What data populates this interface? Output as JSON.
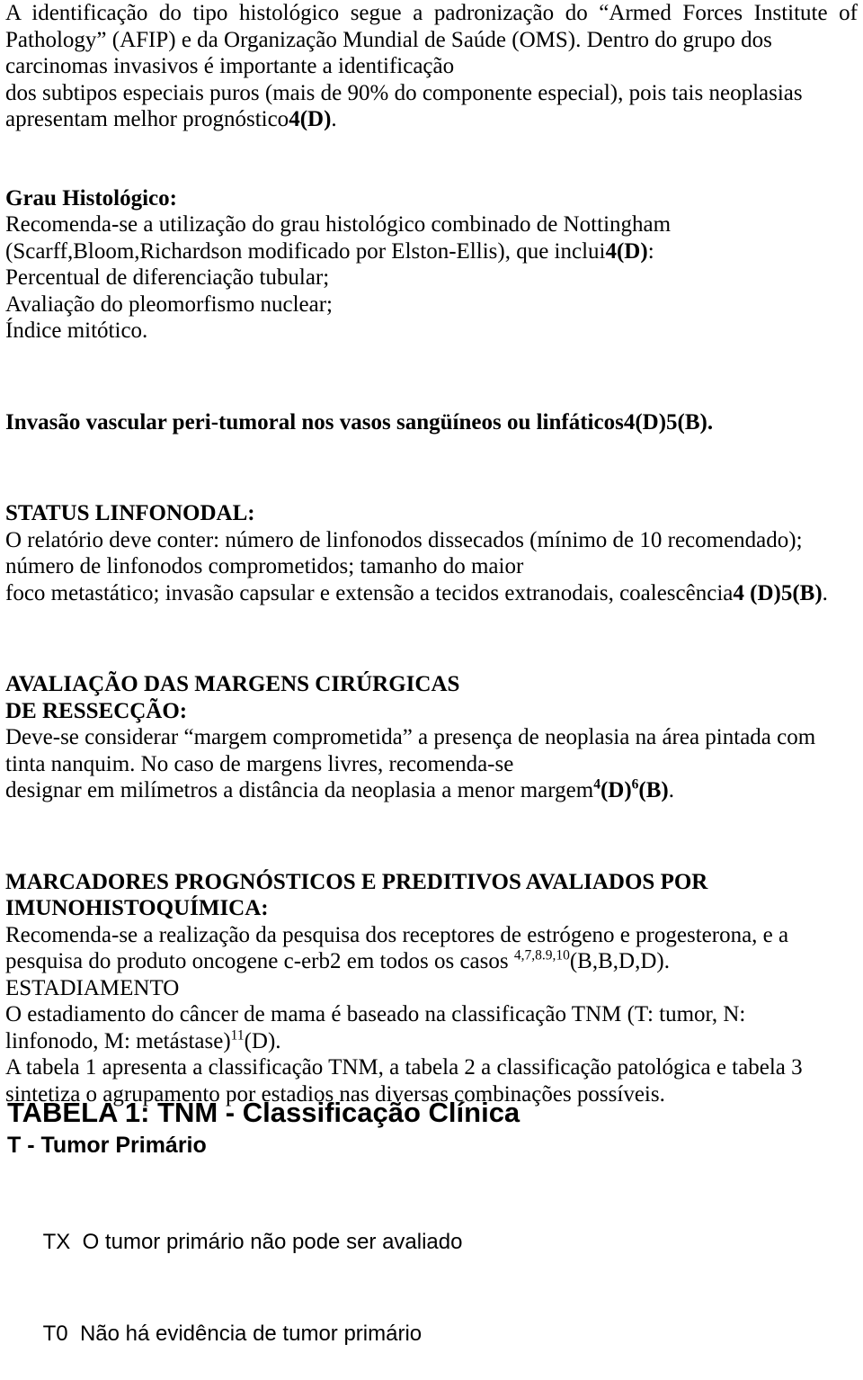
{
  "document": {
    "language": "pt-BR",
    "background_color": "#ffffff",
    "text_color": "#000000"
  },
  "intro": {
    "line1": "A identificação do tipo histológico segue a padronização do “Armed Forces Institute of",
    "line2": "Pathology” (AFIP) e da Organização Mundial de Saúde (OMS). Dentro do grupo dos",
    "line3": "carcinomas invasivos é importante a identificação",
    "line4": "dos subtipos especiais puros (mais de 90% do componente especial), pois tais neoplasias",
    "line5_text": "apresentam melhor prognóstico",
    "line5_ref": "4(D)",
    "line5_end": "."
  },
  "grau": {
    "heading": "Grau Histológico:",
    "line1": "Recomenda-se a utilização do grau histológico combinado de Nottingham",
    "line2_text": "(Scarff,Bloom,Richardson modificado por Elston-Ellis), que inclui",
    "line2_ref": "4(D)",
    "line2_end": ":",
    "item1": "Percentual de diferenciação tubular;",
    "item2": "Avaliação do pleomorfismo nuclear;",
    "item3": "Índice mitótico."
  },
  "invasao": {
    "text": "Invasão vascular peri-tumoral nos vasos sangüíneos ou linfáticos",
    "ref": "4(D)5(B)",
    "end": "."
  },
  "status_linfonodal": {
    "heading": "STATUS LINFONODAL:",
    "line1": "O relatório deve conter: número de linfonodos dissecados (mínimo de 10 recomendado);",
    "line2": "número de linfonodos comprometidos; tamanho do maior",
    "line3_text": "foco metastático; invasão capsular e extensão a tecidos extranodais, coalescência",
    "line3_ref": "4 (D)5(B)",
    "line3_end": "."
  },
  "margens": {
    "heading_line1": "AVALIAÇÃO DAS MARGENS CIRÚRGICAS",
    "heading_line2": "DE RESSECÇÃO:",
    "line1": "Deve-se considerar “margem comprometida” a presença de neoplasia na área pintada com",
    "line2": "tinta nanquim. No caso de margens livres, recomenda-se",
    "line3_text": "designar em milímetros a distância da neoplasia a menor margem",
    "line3_sup1": "4",
    "line3_mid1": "(D)",
    "line3_sup2": "6",
    "line3_mid2": "(B)",
    "line3_end": "."
  },
  "marcadores": {
    "heading_line1": "MARCADORES PROGNÓSTICOS E PREDITIVOS AVALIADOS POR",
    "heading_line2": "IMUNOHISTOQUÍMICA:",
    "line1": "Recomenda-se a realização da pesquisa dos receptores de estrógeno e progesterona, e a",
    "line2_text": "pesquisa do produto oncogene c-erb2 em todos os casos ",
    "line2_sup": "4,7,8.9,10",
    "line2_end": "(B,B,D,D)."
  },
  "estadiamento": {
    "heading": "ESTADIAMENTO",
    "line1": "O estadiamento do câncer de mama é baseado na classificação TNM (T: tumor, N:",
    "line2_text": "linfonodo, M: metástase)",
    "line2_sup": "11",
    "line2_end": "(D).",
    "line3": "A tabela 1 apresenta a classificação TNM, a tabela 2 a classificação patológica e tabela 3",
    "line4": "sintetiza o agrupamento por estadios nas diversas combinações possíveis."
  },
  "tabela1": {
    "title": "TABELA 1: TNM - Classificação Clínica",
    "subtitle": "T - Tumor Primário",
    "rows": [
      {
        "code": "TX",
        "description": "O tumor primário não pode ser avaliado"
      },
      {
        "code": "T0",
        "description": "Não há evidência de tumor primário"
      }
    ]
  }
}
